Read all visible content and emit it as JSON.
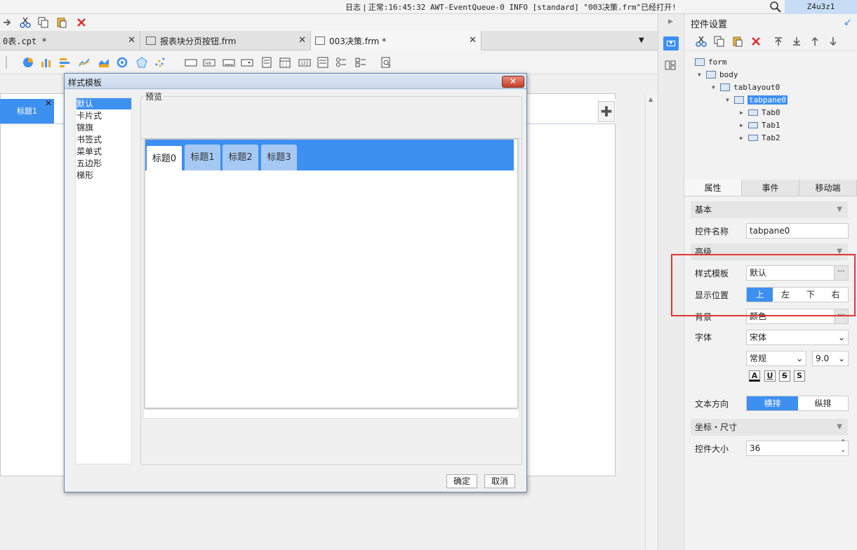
{
  "status": {
    "log_label": "日志",
    "message": "正常:16:45:32 AWT-EventQueue-0 INFO [standard] \"003决策.frm\"已经打开!",
    "user": "Z4u3z1"
  },
  "tabs": [
    {
      "label": "0表.cpt *"
    },
    {
      "label": "报表块分页按钮.frm"
    },
    {
      "label": "003决策.frm *"
    }
  ],
  "canvas": {
    "tab_title": "标题1"
  },
  "right_panel": {
    "title": "控件设置",
    "tree": [
      "form",
      "body",
      "tablayout0",
      "tabpane0",
      "Tab0",
      "Tab1",
      "Tab2"
    ],
    "prop_tabs": [
      "属性",
      "事件",
      "移动端"
    ],
    "sections": {
      "basic": "基本",
      "advanced": "高级",
      "position_size": "坐标・尺寸"
    },
    "props": {
      "name_label": "控件名称",
      "name_value": "tabpane0",
      "style_label": "样式模板",
      "style_value": "默认",
      "position_label": "显示位置",
      "position_options": [
        "上",
        "左",
        "下",
        "右"
      ],
      "position_selected": "上",
      "background_label": "背景",
      "background_value": "颜色",
      "font_label": "字体",
      "font_value": "宋体",
      "font_style": "常规",
      "font_size": "9.0",
      "text_dir_label": "文本方向",
      "text_dir_options": [
        "横排",
        "纵排"
      ],
      "text_dir_selected": "横排",
      "size_label": "控件大小",
      "size_value": "36"
    }
  },
  "dialog": {
    "title": "样式模板",
    "styles": [
      "默认",
      "卡片式",
      "锦旗",
      "书签式",
      "菜单式",
      "五边形",
      "梯形"
    ],
    "selected_style": "默认",
    "preview_label": "预览",
    "preview_tabs": [
      "标题0",
      "标题1",
      "标题2",
      "标题3"
    ],
    "ok": "确定",
    "cancel": "取消"
  },
  "colors": {
    "accent": "#3d8ff0",
    "highlight": "#e03535"
  }
}
